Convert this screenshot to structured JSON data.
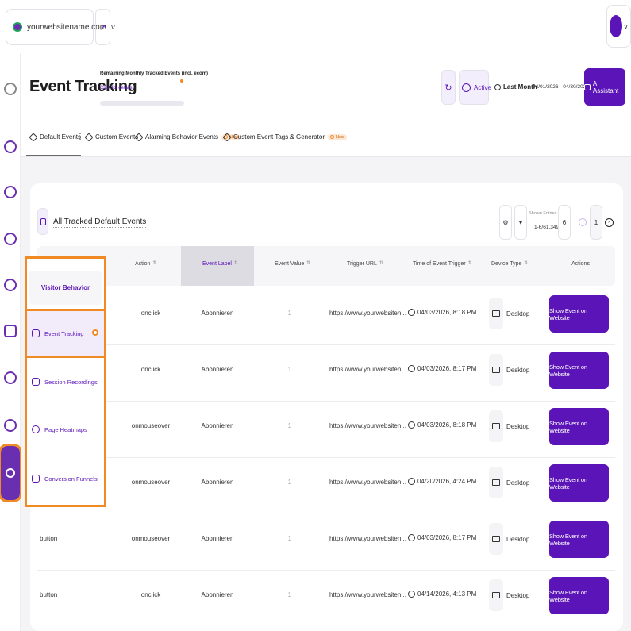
{
  "topbar": {
    "site_name": "yourwebsitename.com",
    "site_chevron": "v",
    "user_chevron": "v"
  },
  "header": {
    "title": "Event Tracking",
    "remaining_title": "Remaining Monthly Tracked Events (incl. ecom)",
    "click_details": "Click for details",
    "status_label": "Active",
    "period_label": "Last Month",
    "date_range": "04/01/2026 - 04/30/2026",
    "ai_label": "AI Assistant"
  },
  "tabs": [
    {
      "label": "Default Events"
    },
    {
      "label": "Custom Events"
    },
    {
      "label": "Alarming Behavior Events",
      "badge": "New"
    },
    {
      "label": "Custom Event Tags & Generator",
      "badge": "New"
    }
  ],
  "card": {
    "title": "All Tracked Default Events",
    "shown_entries_label": "Shown Entries",
    "shown_entries_range": "1-6/61,349",
    "per_page": "6",
    "current_page": "1"
  },
  "table": {
    "columns": [
      "Action",
      "Event Label",
      "Event Value",
      "Trigger URL",
      "Time of Event Trigger",
      "Device Type",
      "Actions"
    ],
    "rows": [
      {
        "event": "",
        "action": "onclick",
        "label": "Abonnieren",
        "value": "1",
        "url": "https://www.yourwebsiten...",
        "time": "04/03/2026, 8:18 PM",
        "device": "Desktop",
        "btn": "Show Event on Website"
      },
      {
        "event": "",
        "action": "onclick",
        "label": "Abonnieren",
        "value": "1",
        "url": "https://www.yourwebsiten...",
        "time": "04/03/2026, 8:17 PM",
        "device": "Desktop",
        "btn": "Show Event on Website"
      },
      {
        "event": "",
        "action": "onmouseover",
        "label": "Abonnieren",
        "value": "1",
        "url": "https://www.yourwebsiten...",
        "time": "04/03/2026, 8:18 PM",
        "device": "Desktop",
        "btn": "Show Event on Website"
      },
      {
        "event": "",
        "action": "onmouseover",
        "label": "Abonnieren",
        "value": "1",
        "url": "https://www.yourwebsiten...",
        "time": "04/20/2026, 4:24 PM",
        "device": "Desktop",
        "btn": "Show Event on Website"
      },
      {
        "event": "button",
        "action": "onmouseover",
        "label": "Abonnieren",
        "value": "1",
        "url": "https://www.yourwebsiten...",
        "time": "04/03/2026, 8:17 PM",
        "device": "Desktop",
        "btn": "Show Event on Website"
      },
      {
        "event": "button",
        "action": "onclick",
        "label": "Abonnieren",
        "value": "1",
        "url": "https://www.yourwebsiten...",
        "time": "04/14/2026, 4:13 PM",
        "device": "Desktop",
        "btn": "Show Event on Website"
      }
    ]
  },
  "submenu": {
    "heading": "Visitor Behavior",
    "items": [
      {
        "label": "Event Tracking",
        "icon": "tag-icon"
      },
      {
        "label": "Session Recordings",
        "icon": "video-icon"
      },
      {
        "label": "Page Heatmaps",
        "icon": "heatmap-icon"
      },
      {
        "label": "Conversion Funnels",
        "icon": "funnel-icon"
      }
    ]
  },
  "colors": {
    "brand": "#5b14b7",
    "highlight": "#f08a24"
  }
}
